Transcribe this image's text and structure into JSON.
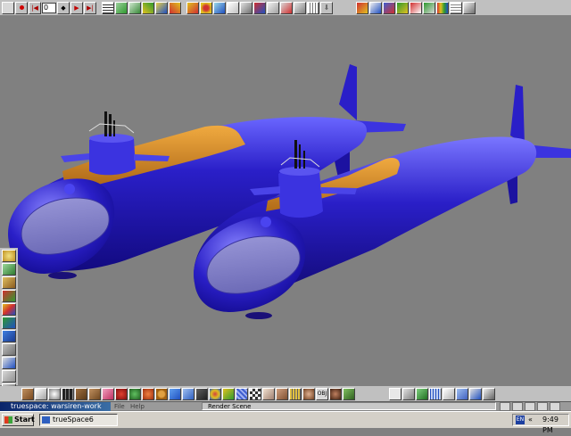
{
  "toolbar": {
    "frame_value": "0",
    "colors": {
      "record": "#d00000",
      "play": "#c00000",
      "accent_green": "#2f9a2f",
      "accent_blue": "#2050c0",
      "accent_yellow": "#e0c020",
      "accent_red": "#d03030"
    }
  },
  "app": {
    "title": "truespace: warsiren-work",
    "menu": {
      "file": "File",
      "help": "Help"
    },
    "status": "Render Scene"
  },
  "taskbar": {
    "start_label": "Start",
    "task_label": "trueSpace6",
    "lang": "EN",
    "clock": "9:49 PM"
  },
  "scene": {
    "background": "#808080",
    "hull_color": "#2a1fc8",
    "deck_color": "#d08a2a"
  },
  "material_bar": {
    "obj_label": "OBJ"
  }
}
